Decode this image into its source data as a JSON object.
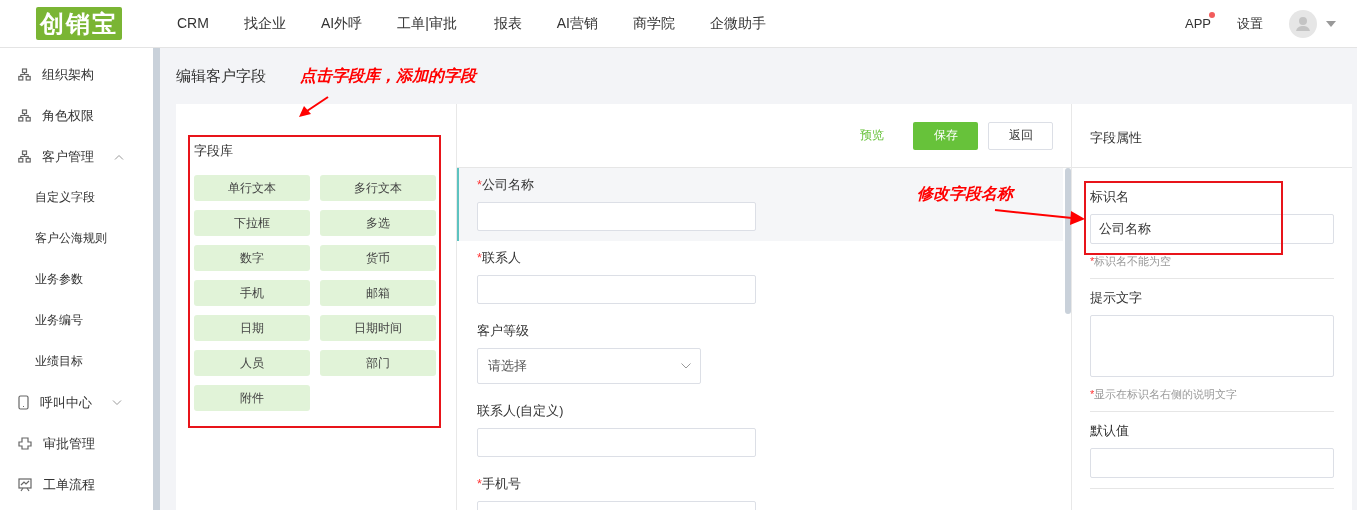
{
  "header": {
    "logo": "创销宝",
    "nav": [
      {
        "label": "CRM"
      },
      {
        "label": "找企业"
      },
      {
        "label": "AI外呼"
      },
      {
        "label": "工单|审批"
      },
      {
        "label": "报表"
      },
      {
        "label": "AI营销"
      },
      {
        "label": "商学院"
      },
      {
        "label": "企微助手"
      }
    ],
    "app": {
      "label": "APP",
      "badge": true
    },
    "settings": "设置"
  },
  "sidebar": {
    "items": [
      {
        "label": "组织架构",
        "kind": "link"
      },
      {
        "label": "角色权限",
        "kind": "link"
      },
      {
        "label": "客户管理",
        "kind": "group",
        "expanded": true,
        "children": [
          {
            "label": "自定义字段"
          },
          {
            "label": "客户公海规则"
          },
          {
            "label": "业务参数"
          },
          {
            "label": "业务编号"
          },
          {
            "label": "业绩目标"
          }
        ]
      },
      {
        "label": "呼叫中心",
        "kind": "group",
        "expanded": false
      },
      {
        "label": "审批管理",
        "kind": "link"
      },
      {
        "label": "工单流程",
        "kind": "link"
      }
    ]
  },
  "page_title": "编辑客户字段",
  "library": {
    "title": "字段库",
    "items": [
      "单行文本",
      "多行文本",
      "下拉框",
      "多选",
      "数字",
      "货币",
      "手机",
      "邮箱",
      "日期",
      "日期时间",
      "人员",
      "部门",
      "附件"
    ]
  },
  "toolbar": {
    "preview": "预览",
    "save": "保存",
    "back": "返回"
  },
  "form": {
    "fields": [
      {
        "label": "公司名称",
        "required_mark": "*",
        "kind": "input",
        "selected": true
      },
      {
        "label": "联系人",
        "required_mark": "*",
        "kind": "input",
        "selected": false
      },
      {
        "label": "客户等级",
        "kind": "select",
        "placeholder": "请选择",
        "selected": false
      },
      {
        "label": "联系人(自定义)",
        "kind": "input",
        "selected": false
      },
      {
        "label": "手机号",
        "required_mark": "*",
        "kind": "input",
        "selected": false
      }
    ]
  },
  "properties": {
    "title": "字段属性",
    "groups": [
      {
        "label": "标识名",
        "kind": "input",
        "value": "公司名称",
        "note_mark": "*",
        "note": "标识名不能为空"
      },
      {
        "label": "提示文字",
        "kind": "textarea",
        "note_mark": "*",
        "note": "显示在标识名右侧的说明文字"
      },
      {
        "label": "默认值",
        "kind": "input"
      }
    ]
  },
  "annotations": [
    {
      "text": "点击字段库，添加的字段"
    },
    {
      "text": "修改字段名称"
    }
  ]
}
